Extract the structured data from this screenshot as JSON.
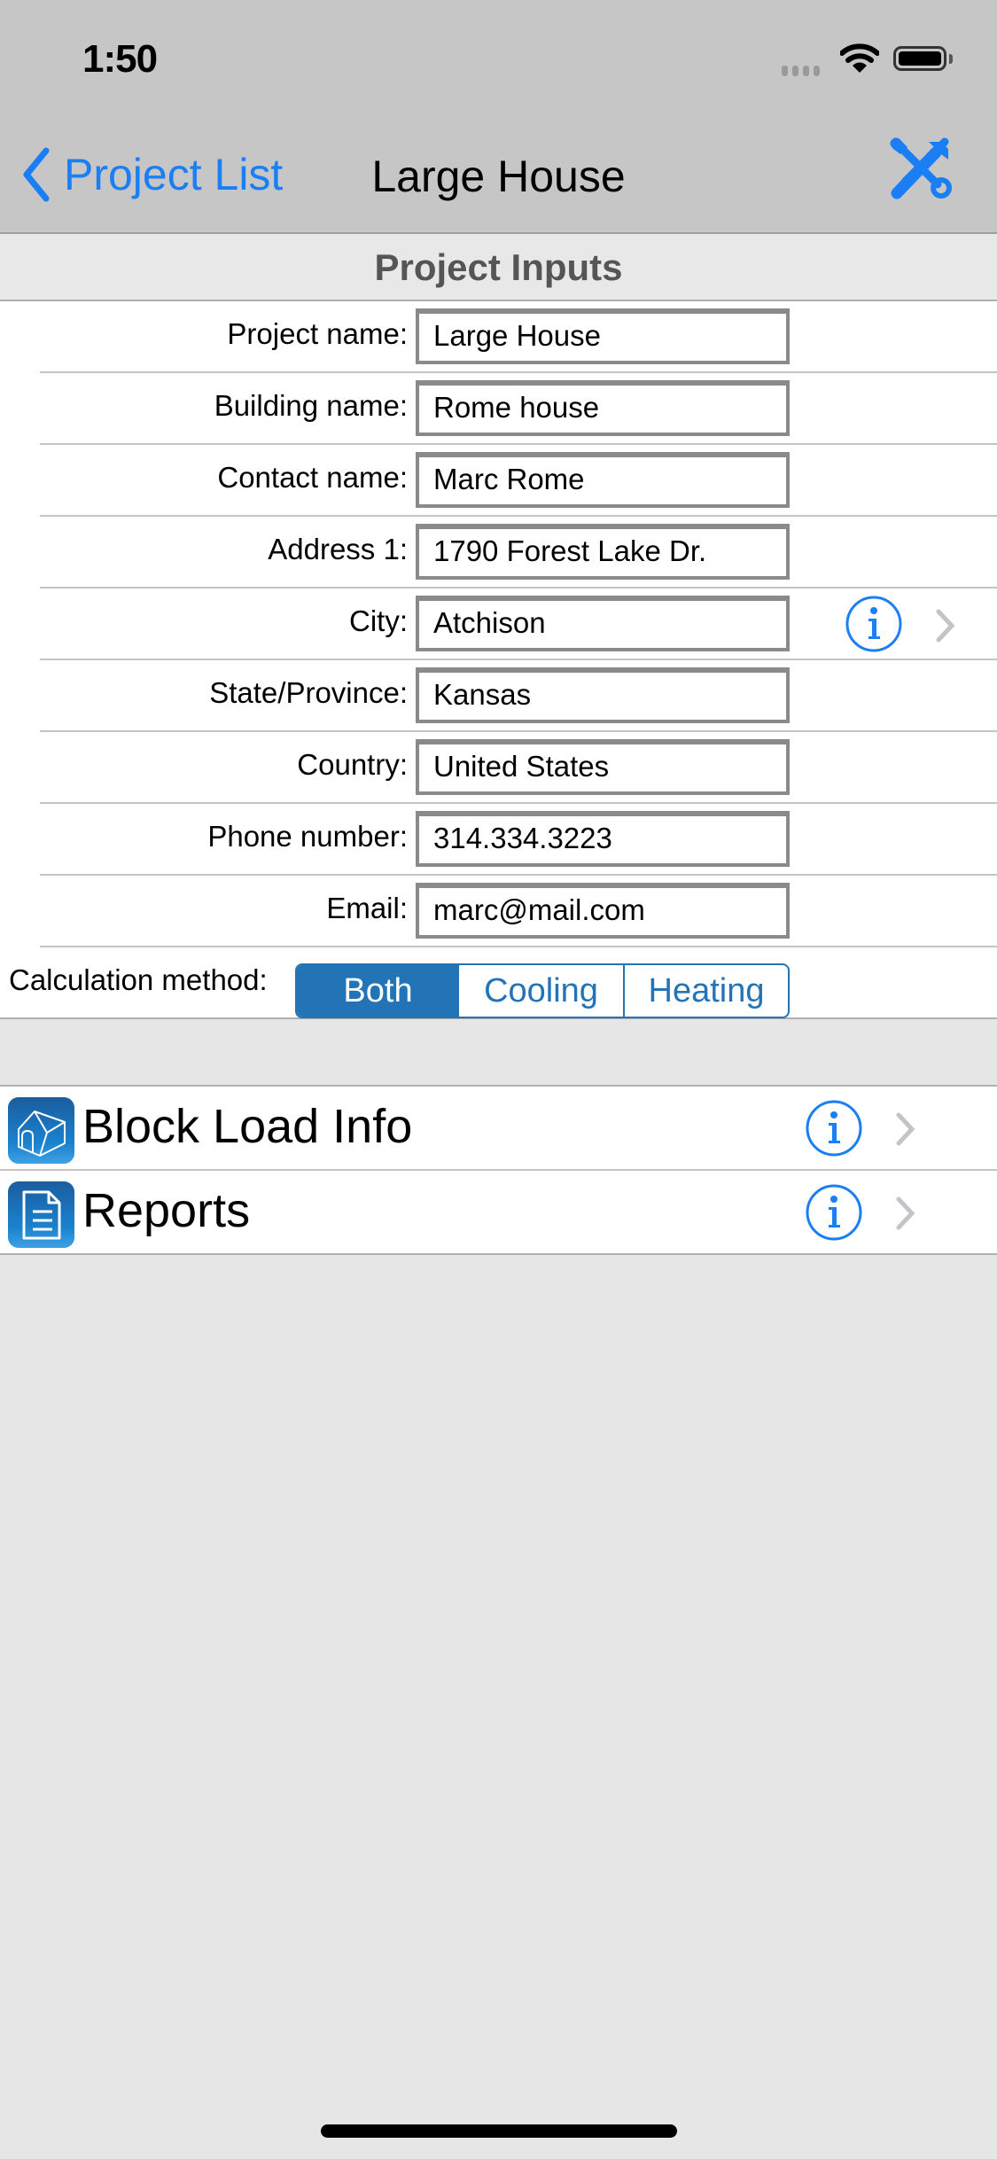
{
  "status_bar": {
    "time": "1:50",
    "icons": [
      "cellular-signal-icon",
      "wifi-icon",
      "battery-icon"
    ]
  },
  "nav_bar": {
    "back_label": "Project List",
    "title": "Large House",
    "right_icon": "tools-icon"
  },
  "section": {
    "title": "Project Inputs"
  },
  "form": {
    "fields": [
      {
        "label": "Project name:",
        "value": "Large House"
      },
      {
        "label": "Building name:",
        "value": "Rome house"
      },
      {
        "label": "Contact name:",
        "value": "Marc Rome"
      },
      {
        "label": "Address 1:",
        "value": "1790 Forest Lake Dr."
      },
      {
        "label": "City:",
        "value": "Atchison"
      },
      {
        "label": "State/Province:",
        "value": "Kansas"
      },
      {
        "label": "Country:",
        "value": "United States"
      },
      {
        "label": "Phone number:",
        "value": "314.334.3223"
      },
      {
        "label": "Email:",
        "value": "marc@mail.com"
      }
    ],
    "calc_method": {
      "label": "Calculation method:",
      "options": [
        "Both",
        "Cooling",
        "Heating"
      ],
      "selected": "Both"
    }
  },
  "menu": {
    "items": [
      {
        "label": "Block Load Info",
        "icon": "house-icon"
      },
      {
        "label": "Reports",
        "icon": "document-icon"
      }
    ]
  },
  "colors": {
    "accent": "#1a7ef5",
    "segment": "#2374b7",
    "bar_bg": "#c6c6c6",
    "page_bg": "#e6e6e6"
  }
}
